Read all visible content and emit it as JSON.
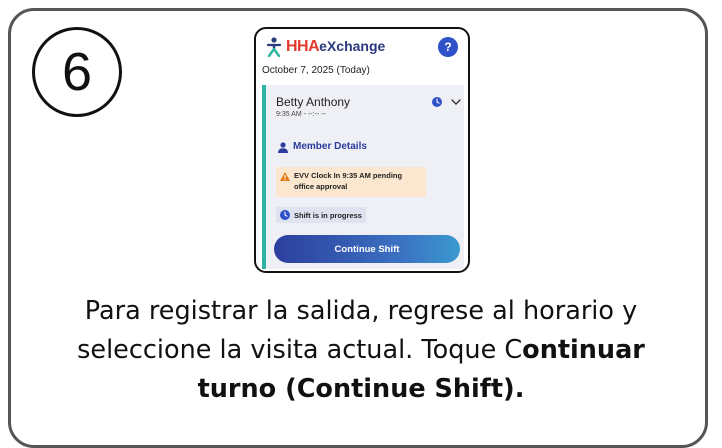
{
  "step": {
    "number": "6"
  },
  "app": {
    "logo_hha": "HHA",
    "logo_exchange": "eXchange",
    "help_label": "?",
    "date": "October 7, 2025 (Today)",
    "visit": {
      "client_name": "Betty Anthony",
      "time": "9:35 AM - --:-- --",
      "member_details_label": "Member Details",
      "alert_text": "EVV Clock In 9:35 AM pending office approval",
      "status_text": "Shift is in progress",
      "continue_button_label": "Continue Shift"
    }
  },
  "caption": {
    "line1": "Para registrar la salida, regrese al horario y",
    "line2_plain": "seleccione la visita actual. Toque C",
    "line2_bold": "ontinuar",
    "line3_bold": "turno (Continue Shift)."
  },
  "colors": {
    "brand_red": "#e23a2f",
    "brand_navy": "#2a3a7e",
    "accent_blue": "#2f52c9",
    "teal_stripe": "#2bb3a3",
    "alert_bg": "#fbe7cf",
    "warning_orange": "#e07a10"
  }
}
